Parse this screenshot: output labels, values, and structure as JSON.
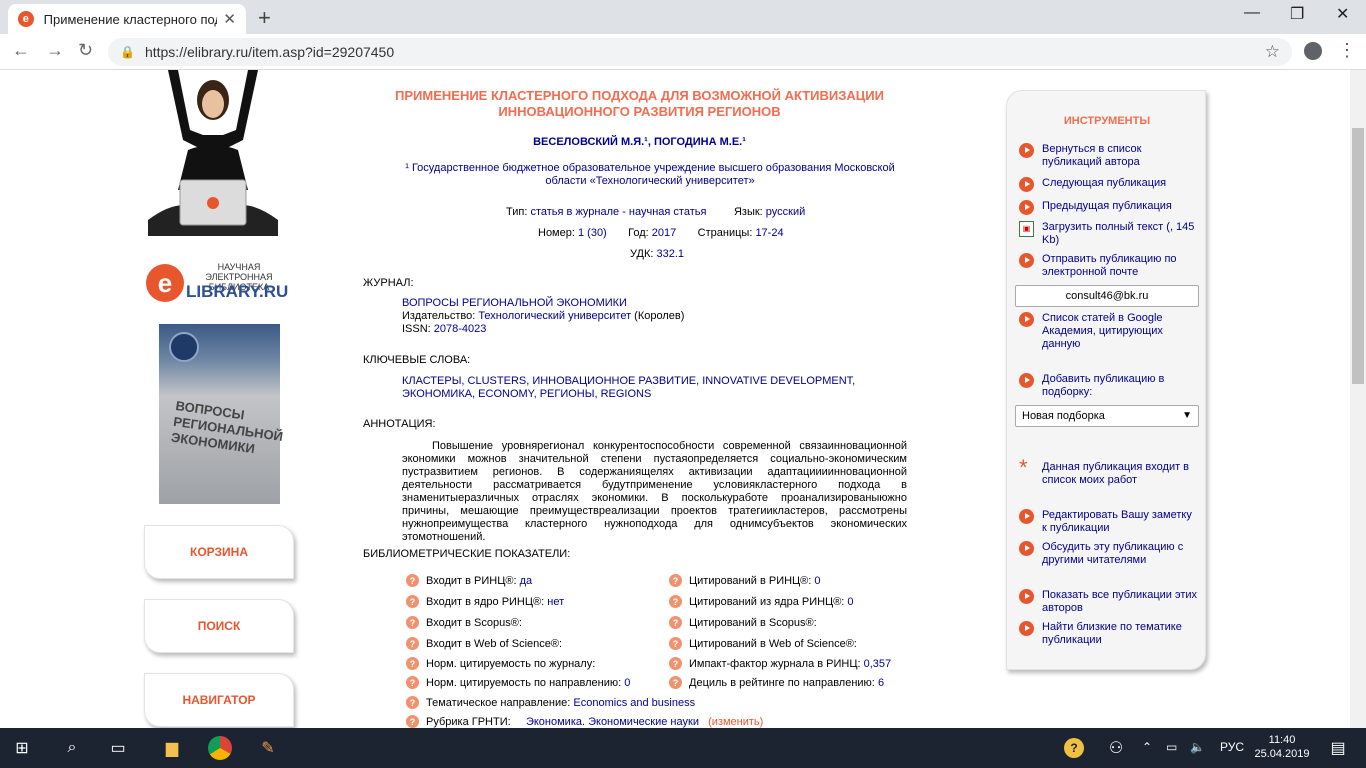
{
  "browser": {
    "tab_title": "Применение кластерного подхо",
    "url": "https://elibrary.ru/item.asp?id=29207450"
  },
  "left": {
    "logo_line1": "НАУЧНАЯ ЭЛЕКТРОННАЯ БИБЛИОТЕКА",
    "logo_brand": "LIBRARY.RU",
    "logo_letter": "e",
    "cover_text": "ВОПРОСЫ РЕГИОНАЛЬНОЙ ЭКОНОМИКИ",
    "buttons": [
      "КОРЗИНА",
      "ПОИСК",
      "НАВИГАТОР"
    ]
  },
  "article": {
    "title": "ПРИМЕНЕНИЕ КЛАСТЕРНОГО ПОДХОДА ДЛЯ ВОЗМОЖНОЙ АКТИВИЗАЦИИ ИННОВАЦИОННОГО РАЗВИТИЯ РЕГИОНОВ",
    "authors": "ВЕСЕЛОВСКИЙ М.Я.¹, ПОГОДИНА М.Е.¹",
    "affiliation": "¹ Государственное бюджетное образовательное учреждение высшего образования Московской области «Технологический университет»",
    "type_label": "Тип:",
    "type_value": "статья в журнале - научная статья",
    "lang_label": "Язык:",
    "lang_value": "русский",
    "number_label": "Номер:",
    "number_value": "1 (30)",
    "year_label": "Год:",
    "year_value": "2017",
    "pages_label": "Страницы:",
    "pages_value": "17-24",
    "udk_label": "УДК:",
    "udk_value": "332.1",
    "journal_heading": "ЖУРНАЛ:",
    "journal_name": "ВОПРОСЫ РЕГИОНАЛЬНОЙ ЭКОНОМИКИ",
    "publisher_label": "Издательство:",
    "publisher_value": "Технологический университет",
    "publisher_city": "(Королев)",
    "issn_label": "ISSN:",
    "issn_value": "2078-4023",
    "keywords_heading": "КЛЮЧЕВЫЕ СЛОВА:",
    "keywords": "КЛАСТЕРЫ, CLUSTERS, ИННОВАЦИОННОЕ РАЗВИТИЕ, INNOVATIVE DEVELOPMENT, ЭКОНОМИКА, ECONOMY, РЕГИОНЫ, REGIONS",
    "abstract_heading": "АННОТАЦИЯ:",
    "abstract": "Повышение уровнярегионал конкурентоспособности современной связаинновационной экономики можнов значительной степени пустаяопределяется социально-экономическим пустразвитием регионов. В содержаниящелях активизации адаптациииинновационной деятельности рассматривается будутприменение условиякластерного подхода в знаменитыеразличных отраслях экономики. В посколькуработе проанализированыюжно причины, мешающие преимуществреализации проектов тратегиикластеров, рассмотрены нужнопреимущества кластерного нужноподхода для однимсубъектов экономических этомотношений.",
    "biblio_heading": "БИБЛИОМЕТРИЧЕСКИЕ ПОКАЗАТЕЛИ:"
  },
  "metrics_left": [
    {
      "label": "Входит в РИНЦ®:",
      "value": "да"
    },
    {
      "label": "Входит в ядро РИНЦ®:",
      "value": "нет"
    },
    {
      "label": "Входит в Scopus®:",
      "value": ""
    },
    {
      "label": "Входит в Web of Science®:",
      "value": ""
    },
    {
      "label": "Норм. цитируемость по журналу:",
      "value": ""
    },
    {
      "label": "Норм. цитируемость по направлению:",
      "value": "0"
    },
    {
      "label": "Тематическое направление:",
      "value": "Economics and business"
    },
    {
      "label": "Рубрика ГРНТИ:",
      "value": "Экономика. Экономические науки"
    }
  ],
  "metrics_right": [
    {
      "label": "Цитирований в РИНЦ®:",
      "value": "0"
    },
    {
      "label": "Цитирований из ядра РИНЦ®:",
      "value": "0"
    },
    {
      "label": "Цитирований в Scopus®:",
      "value": ""
    },
    {
      "label": "Цитирований в Web of Science®:",
      "value": ""
    },
    {
      "label": "Импакт-фактор журнала в РИНЦ:",
      "value": "0,357"
    },
    {
      "label": "Дециль в рейтинге по направлению:",
      "value": "6"
    }
  ],
  "rubric_change": "(изменить)",
  "tools": {
    "title": "ИНСТРУМЕНТЫ",
    "items": [
      "Вернуться в список публикаций автора",
      "Следующая публикация",
      "Предыдущая публикация",
      "Загрузить полный текст (, 145 Kb)",
      "Отправить публикацию по электронной почте",
      "Список статей в Google Академия, цитирующих данную",
      "Добавить публикацию в подборку:",
      "Данная публикация входит в список моих работ",
      "Редактировать Вашу заметку к публикации",
      "Обсудить эту публикацию с другими читателями",
      "Показать все публикации этих авторов",
      "Найти близкие по тематике публикации"
    ],
    "email": "consult46@bk.ru",
    "collection_select": "Новая подборка"
  },
  "taskbar": {
    "lang": "РУС",
    "time": "11:40",
    "date": "25.04.2019"
  }
}
